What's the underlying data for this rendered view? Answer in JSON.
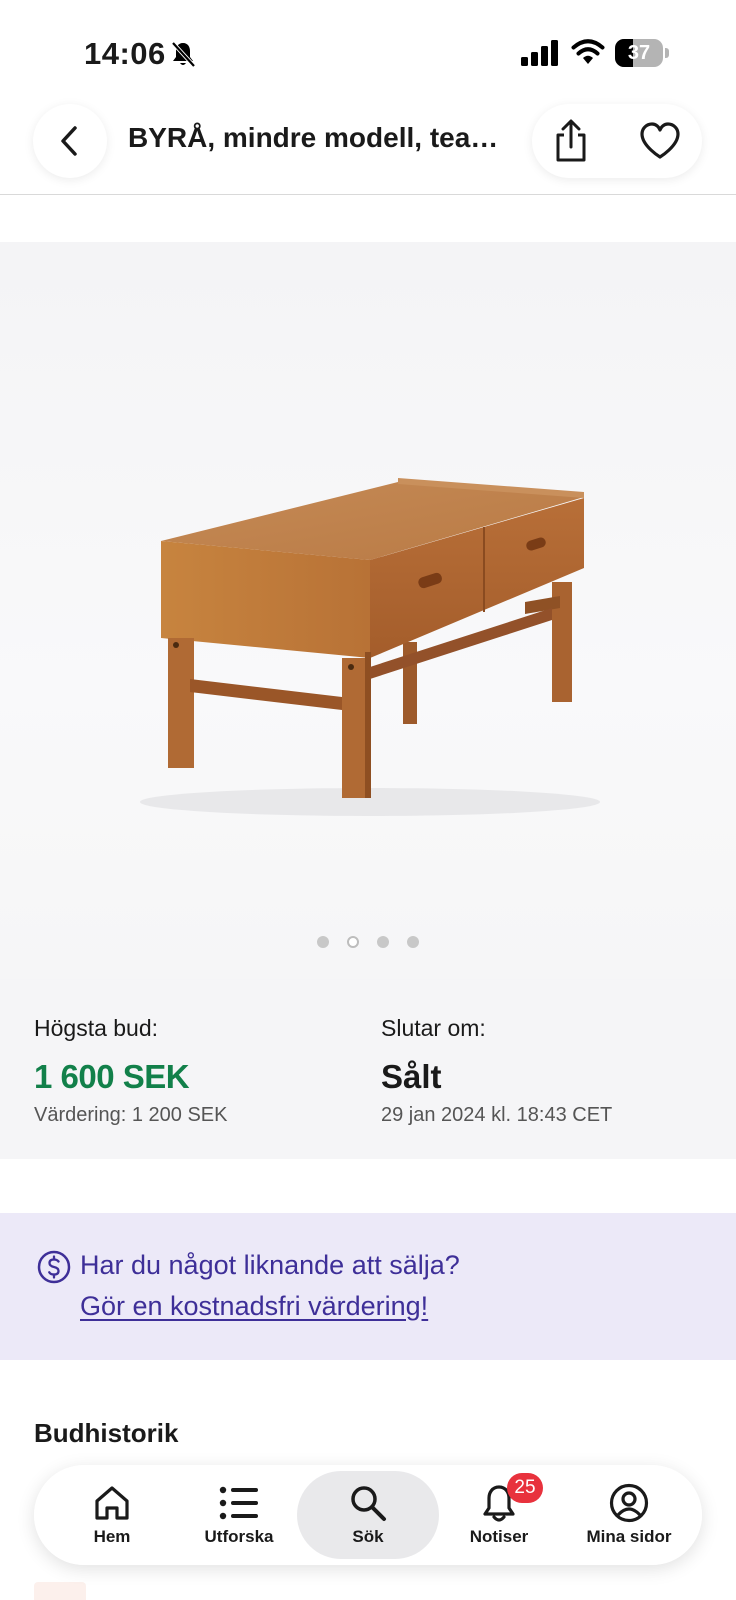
{
  "status_bar": {
    "time": "14:06",
    "battery_level": "37",
    "icons": [
      "bell-muted-icon",
      "signal-icon",
      "wifi-icon",
      "battery-icon"
    ]
  },
  "header": {
    "title": "BYRÅ, mindre modell, teak...",
    "icons": [
      "chevron-left-icon",
      "share-icon",
      "heart-icon"
    ]
  },
  "gallery": {
    "image_count": 4,
    "active_index": 1
  },
  "bid_info": {
    "highest_bid_label": "Högsta bud:",
    "highest_bid": "1 600 SEK",
    "valuation": "Värdering: 1 200 SEK",
    "ends_label": "Slutar om:",
    "status": "Sålt",
    "end_time": "29 jan 2024 kl. 18:43 CET"
  },
  "sell_banner": {
    "question": "Har du något liknande att sälja?",
    "link": "Gör en kostnadsfri värdering!"
  },
  "history": {
    "title": "Budhistorik"
  },
  "nav": {
    "items": [
      {
        "label": "Hem",
        "icon": "home-icon"
      },
      {
        "label": "Utforska",
        "icon": "list-icon"
      },
      {
        "label": "Sök",
        "icon": "search-icon"
      },
      {
        "label": "Notiser",
        "icon": "bell-icon"
      },
      {
        "label": "Mina sidor",
        "icon": "user-circle-icon"
      }
    ],
    "active": "Sök",
    "notification_count": "25"
  },
  "colors": {
    "bid_green": "#12804a",
    "banner_bg": "#ece9f8",
    "banner_text": "#3e2f98",
    "badge_red": "#e8323d"
  }
}
